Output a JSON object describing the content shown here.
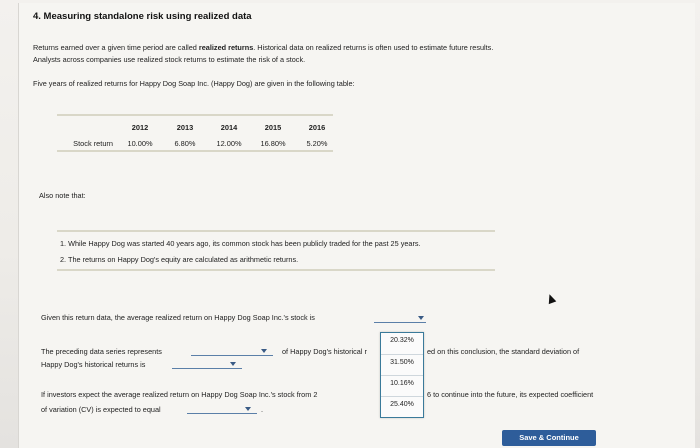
{
  "question": {
    "title": "4. Measuring standalone risk using realized data",
    "intro_line1_pre": "Returns earned over a given time period are called ",
    "intro_line1_bold": "realized returns",
    "intro_line1_post": ". Historical data on realized returns is often used to estimate future results.",
    "intro_line2": "Analysts across companies use realized stock returns to estimate the risk of a stock.",
    "intro_line3": "Five years of realized returns for Happy Dog Soap Inc. (Happy Dog) are given in the following table:"
  },
  "returns_table": {
    "years": [
      "2012",
      "2013",
      "2014",
      "2015",
      "2016"
    ],
    "row_label": "Stock return",
    "values": [
      "10.00%",
      "6.80%",
      "12.00%",
      "16.80%",
      "5.20%"
    ]
  },
  "notes": {
    "heading": "Also note that:",
    "items": [
      "1. While Happy Dog was started 40 years ago, its common stock has been publicly traded for the past 25 years.",
      "2. The returns on Happy Dog's equity are calculated as arithmetic returns."
    ]
  },
  "questions": {
    "q1_text": "Given this return data, the average realized return on Happy Dog Soap Inc.'s stock is",
    "q1_selected": "",
    "q2_line1_pre": "The preceding data series represents",
    "q2_line1_mid": "of Happy Dog's historical r",
    "q2_line1_post": "ed on this conclusion, the standard deviation of",
    "q2_line2_pre": "Happy Dog's historical returns is",
    "q3_line1_pre": "If investors expect the average realized return on Happy Dog Soap Inc.'s stock from 2",
    "q3_line1_post": "6 to continue into the future, its expected coefficient",
    "q3_line2_pre": "of variation (CV) is expected to equal",
    "q3_line2_post": "."
  },
  "dropdown_options": [
    "20.32%",
    "31.50%",
    "10.16%",
    "25.40%"
  ],
  "buttons": {
    "save_continue": "Save & Continue"
  },
  "colors": {
    "accent": "#2e5d9a",
    "dropdown_border": "#3a7a9a",
    "select_line": "#5b7fa8"
  }
}
